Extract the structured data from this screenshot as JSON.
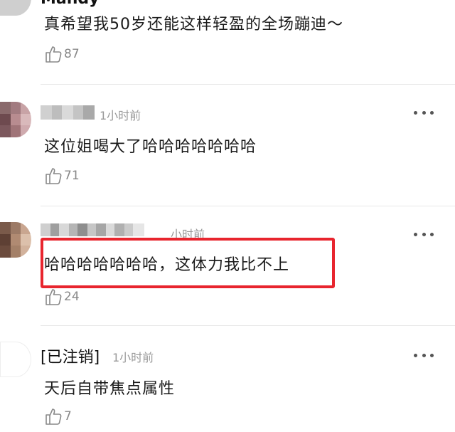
{
  "comments": [
    {
      "username": "Mandy",
      "time": "",
      "text": "真希望我50岁还能这样轻盈的全场蹦迪～",
      "likes": "87"
    },
    {
      "username": "",
      "time": "1小时前",
      "text": "这位姐喝大了哈哈哈哈哈哈哈",
      "likes": "71"
    },
    {
      "username": "",
      "time": "小时前",
      "text": "哈哈哈哈哈哈哈，这体力我比不上",
      "likes": "24"
    },
    {
      "username": "[已注销]",
      "time": "1小时前",
      "text": "天后自带焦点属性",
      "likes": "7"
    }
  ],
  "icons": {
    "like": "thumbs-up-icon",
    "more": "more-dots-icon"
  },
  "colors": {
    "highlight": "#e8252e",
    "muted": "#999999",
    "divider": "#e8e8e8"
  }
}
